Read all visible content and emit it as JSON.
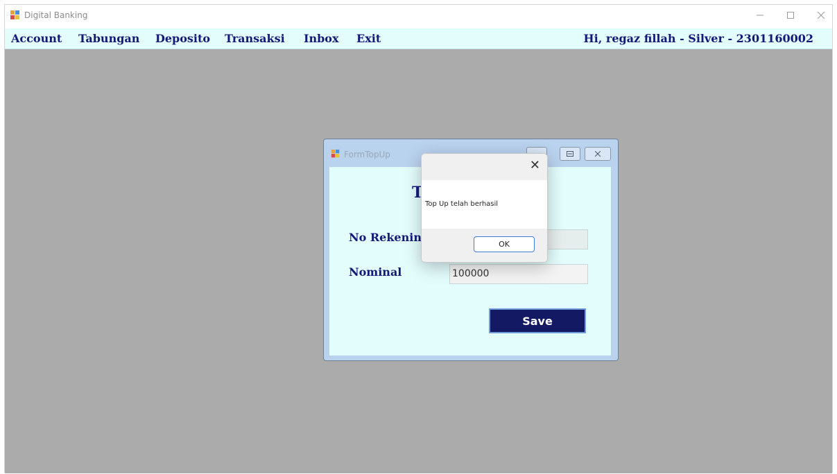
{
  "window": {
    "title": "Digital Banking",
    "icon": "app-icon"
  },
  "menubar": {
    "items": [
      "Account",
      "Tabungan",
      "Deposito",
      "Transaksi",
      "Inbox",
      "Exit"
    ],
    "greeting": "Hi, regaz fillah - Silver - 2301160002"
  },
  "form": {
    "title": "FormTopUp",
    "heading": "T",
    "fields": {
      "rekening_label": "No Rekenin",
      "rekening_value": "",
      "nominal_label": "Nominal",
      "nominal_value": "100000"
    },
    "save_label": "Save"
  },
  "messagebox": {
    "text": "Top Up telah berhasil",
    "ok_label": "OK"
  },
  "colors": {
    "menubar_bg": "#e3fcfc",
    "menu_text": "#121a78",
    "save_bg": "#141963",
    "mdi_bg": "#ababab"
  }
}
